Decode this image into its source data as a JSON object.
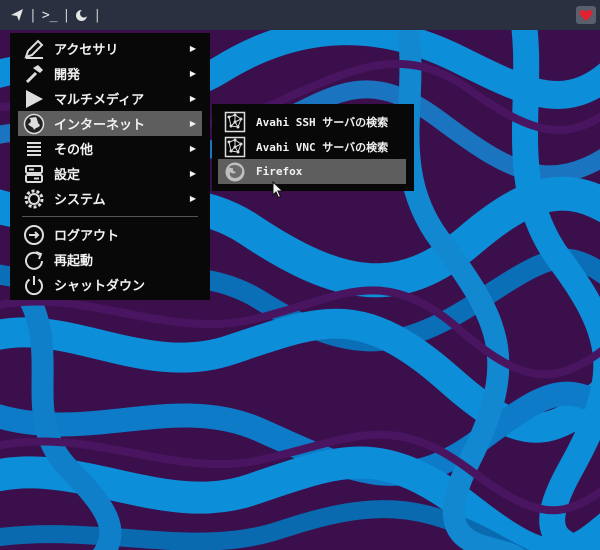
{
  "panel": {
    "separators": [
      "|",
      "|",
      "|"
    ],
    "terminal_label": ">_"
  },
  "menu": {
    "items": [
      {
        "label": "アクセサリ",
        "icon": "pencil-ruler-icon",
        "has_submenu": true
      },
      {
        "label": "開発",
        "icon": "hammer-icon",
        "has_submenu": true
      },
      {
        "label": "マルチメディア",
        "icon": "play-icon",
        "has_submenu": true
      },
      {
        "label": "インターネット",
        "icon": "globe-icon",
        "has_submenu": true,
        "active": true
      },
      {
        "label": "その他",
        "icon": "lines-icon",
        "has_submenu": true
      },
      {
        "label": "設定",
        "icon": "settings-icon",
        "has_submenu": true
      },
      {
        "label": "システム",
        "icon": "gear-icon",
        "has_submenu": true
      }
    ],
    "actions": [
      {
        "label": "ログアウト",
        "icon": "logout-icon"
      },
      {
        "label": "再起動",
        "icon": "restart-icon"
      },
      {
        "label": "シャットダウン",
        "icon": "power-icon"
      }
    ],
    "arrow": "▶"
  },
  "submenu": {
    "items": [
      {
        "label": "Avahi SSH サーバの検索",
        "icon": "network-icon"
      },
      {
        "label": "Avahi VNC サーバの検索",
        "icon": "network-icon"
      },
      {
        "label": "Firefox",
        "icon": "firefox-icon",
        "active": true
      }
    ]
  },
  "colors": {
    "panel_bg": "#2a3040",
    "menu_bg": "#080808",
    "highlight": "#5e5e5e",
    "wallpaper_blue": "#0a8fd8",
    "wallpaper_purple": "#3b0f4d",
    "heart": "#e0212f"
  }
}
